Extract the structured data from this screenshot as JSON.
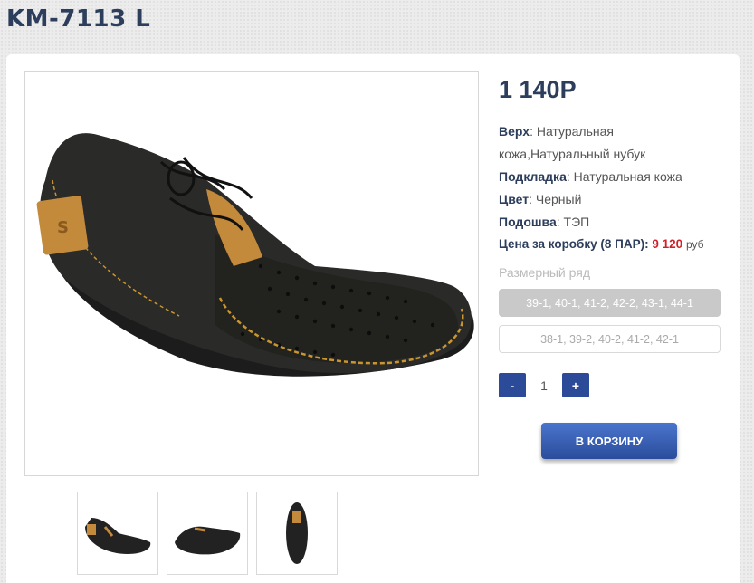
{
  "product": {
    "title": "KM-7113 L",
    "price": "1 140Р"
  },
  "specs": {
    "upper_label": "Верх",
    "upper_value": ": Натуральная кожа,Натуральный нубук",
    "lining_label": "Подкладка",
    "lining_value": ": Натуральная кожа",
    "color_label": "Цвет",
    "color_value": ": Черный",
    "sole_label": "Подошва",
    "sole_value": ": ТЭП"
  },
  "box": {
    "label": "Цена за коробку (8 ПАР):",
    "amount": "9 120",
    "currency": "руб"
  },
  "sizes": {
    "label": "Размерный ряд",
    "options": [
      "39-1, 40-1, 41-2, 42-2, 43-1, 44-1",
      "38-1, 39-2, 40-2, 41-2, 42-1"
    ],
    "selected": "39-1, 40-1, 41-2, 42-2, 43-1, 44-1"
  },
  "quantity": {
    "minus": "-",
    "value": "1",
    "plus": "+"
  },
  "cart_button": "В КОРЗИНУ",
  "colors": {
    "title": "#2c3e5c",
    "accent_blue": "#2b4a98",
    "price_red": "#d0212a"
  },
  "images": {
    "main": "shoe-side-view",
    "thumbs": [
      "shoe-angle-thumb",
      "shoe-side-thumb",
      "shoe-top-thumb"
    ]
  }
}
